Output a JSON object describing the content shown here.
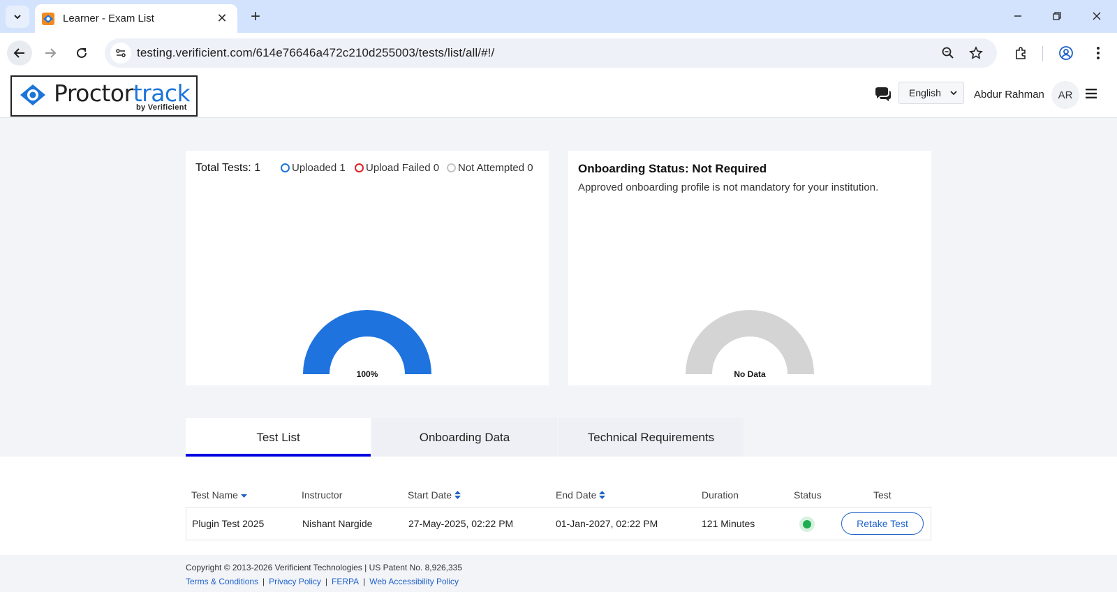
{
  "browser": {
    "tab_title": "Learner - Exam List",
    "url": "testing.verificient.com/614e76646a472c210d255003/tests/list/all/#!/"
  },
  "header": {
    "logo_main": "Proctor",
    "logo_accent": "track",
    "logo_sub": "by Verificient",
    "language": "English",
    "user_name": "Abdur Rahman",
    "avatar_initials": "AR"
  },
  "summary": {
    "total_tests": "Total Tests: 1",
    "legend": [
      {
        "label": "Uploaded 1",
        "color": "#1d74d9"
      },
      {
        "label": "Upload Failed 0",
        "color": "#e02020"
      },
      {
        "label": "Not Attempted 0",
        "color": "#c4c4c4"
      }
    ],
    "gauge_label": "100%",
    "gauge_color": "#1f73de",
    "gauge_fraction": 1.0
  },
  "onboarding": {
    "title": "Onboarding Status: Not Required",
    "description": "Approved onboarding profile is not mandatory for your institution.",
    "gauge_label": "No Data",
    "gauge_color": "#d4d4d4"
  },
  "tabs": [
    "Test List",
    "Onboarding Data",
    "Technical Requirements"
  ],
  "table": {
    "headers": {
      "name": "Test Name",
      "instructor": "Instructor",
      "start": "Start Date",
      "end": "End Date",
      "duration": "Duration",
      "status": "Status",
      "test": "Test"
    },
    "rows": [
      {
        "name": "Plugin Test 2025",
        "instructor": "Nishant Nargide",
        "start": "27-May-2025, 02:22 PM",
        "end": "01-Jan-2027, 02:22 PM",
        "duration": "121 Minutes",
        "status_color": "#1fad51",
        "action": "Retake Test"
      }
    ]
  },
  "footer": {
    "copyright": "Copyright © 2013-2026 Verificient Technologies | US Patent No. 8,926,335",
    "links": [
      "Terms & Conditions",
      "Privacy Policy",
      "FERPA",
      "Web Accessibility Policy"
    ]
  }
}
